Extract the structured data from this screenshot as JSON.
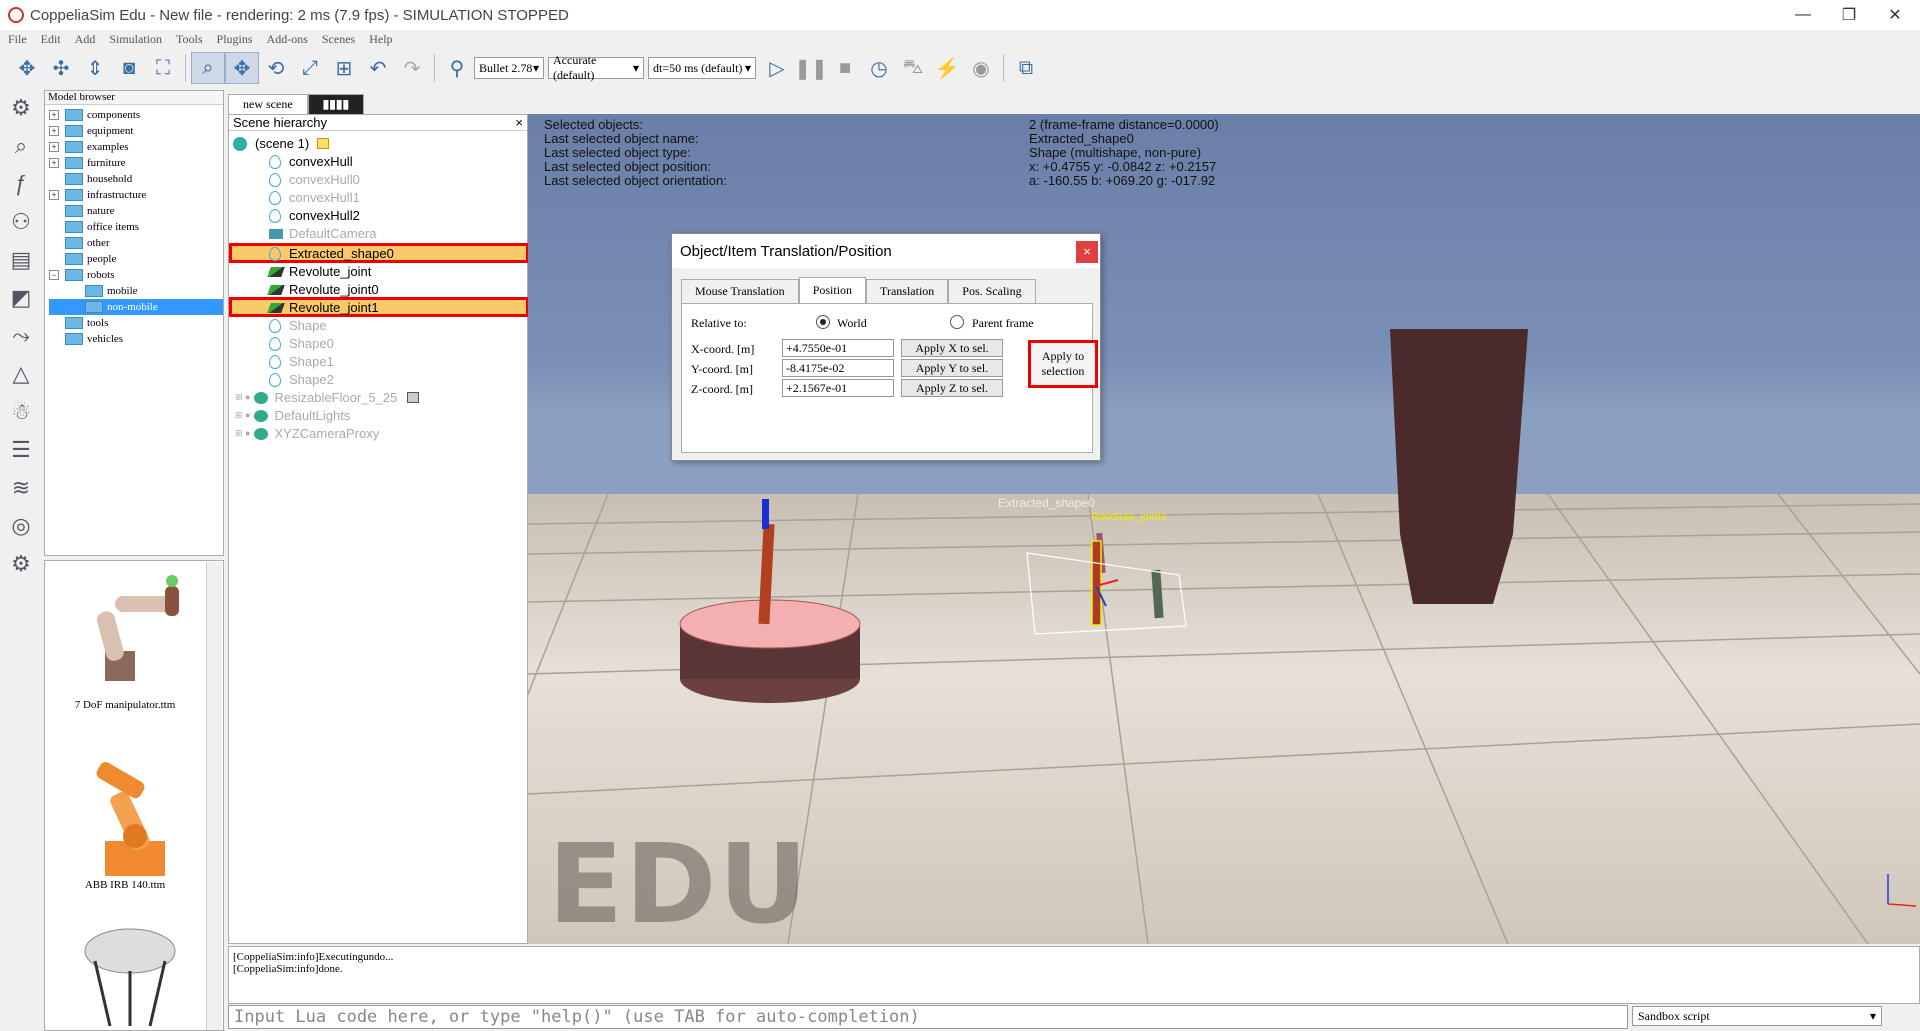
{
  "window": {
    "title": "CoppeliaSim Edu - New file - rendering: 2 ms (7.9 fps) - SIMULATION STOPPED"
  },
  "menu": [
    "File",
    "Edit",
    "Add",
    "Simulation",
    "Tools",
    "Plugins",
    "Add-ons",
    "Scenes",
    "Help"
  ],
  "toolbar": {
    "engine": "Bullet 2.78",
    "accuracy": "Accurate (default)",
    "dt": "dt=50 ms (default)"
  },
  "model_browser": {
    "header": "Model browser",
    "items": [
      "components",
      "equipment",
      "examples",
      "furniture",
      "household",
      "infrastructure",
      "nature",
      "office items",
      "other",
      "people",
      "robots",
      "mobile",
      "non-mobile",
      "tools",
      "vehicles"
    ]
  },
  "model_thumbs": [
    "7 DoF manipulator.ttm",
    "ABB IRB 140.ttm"
  ],
  "scene_tabs": [
    "new scene",
    "▮▮▮▮"
  ],
  "scene_hierarchy": {
    "header": "Scene hierarchy",
    "close": "×",
    "root": "(scene 1)",
    "items": [
      "convexHull",
      "convexHull0",
      "convexHull1",
      "convexHull2",
      "DefaultCamera",
      "Extracted_shape0",
      "Revolute_joint",
      "Revolute_joint0",
      "Revolute_joint1",
      "Shape",
      "Shape0",
      "Shape1",
      "Shape2",
      "ResizableFloor_5_25",
      "DefaultLights",
      "XYZCameraProxy"
    ]
  },
  "view_info": [
    {
      "k": "Selected objects:",
      "v": "2 (frame-frame distance=0.0000)"
    },
    {
      "k": "Last selected object name:",
      "v": "Extracted_shape0"
    },
    {
      "k": "Last selected object type:",
      "v": "Shape (multishape, non-pure)"
    },
    {
      "k": "Last selected object position:",
      "v": "x: +0.4755    y: -0.0842    z: +0.2157"
    },
    {
      "k": "Last selected object orientation:",
      "v": "a: -160.55    b: +069.20    g: -017.92"
    }
  ],
  "scene_labels": {
    "shape": "Extracted_shape0",
    "joint": "Revolute_joint1",
    "watermark": "EDU"
  },
  "dialog": {
    "title": "Object/Item Translation/Position",
    "close": "×",
    "tabs": [
      "Mouse Translation",
      "Position",
      "Translation",
      "Pos. Scaling"
    ],
    "relative_to": "Relative to:",
    "world": "World",
    "parent": "Parent frame",
    "x_label": "X-coord. [m]",
    "x_value": "+4.7550e-01",
    "x_btn": "Apply X to sel.",
    "y_label": "Y-coord. [m]",
    "y_value": "-8.4175e-02",
    "y_btn": "Apply Y to sel.",
    "z_label": "Z-coord. [m]",
    "z_value": "+2.1567e-01",
    "z_btn": "Apply Z to sel.",
    "apply_all": "Apply to selection"
  },
  "console": [
    "[CoppeliaSim:info]Executingundo...",
    "[CoppeliaSim:info]done."
  ],
  "lua_placeholder": "Input Lua code here, or type \"help()\" (use TAB for auto-completion)",
  "script_select": "Sandbox script"
}
